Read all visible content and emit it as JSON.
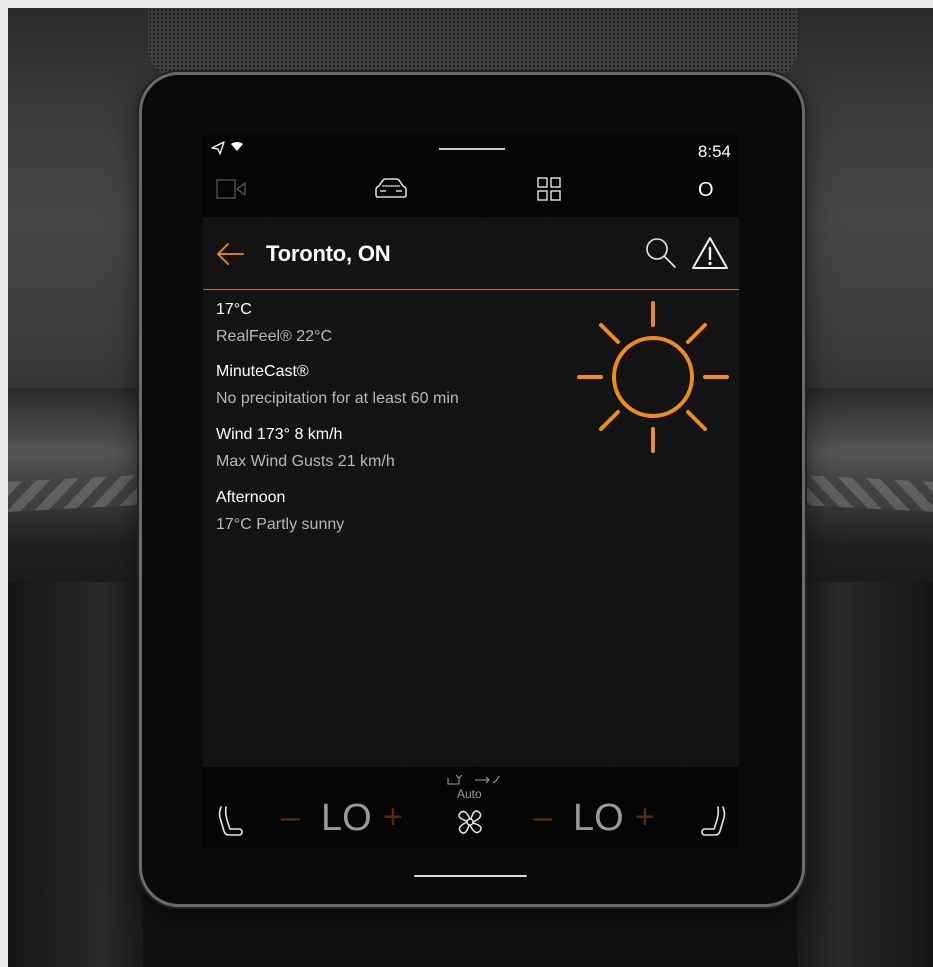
{
  "status_bar": {
    "time": "8:54"
  },
  "app_bar": {
    "icons": [
      "camera-icon",
      "car-icon",
      "app-grid-icon",
      "profile-icon"
    ],
    "profile_label": "O"
  },
  "weather": {
    "city": "Toronto, ON",
    "temperature": "17°C",
    "realfeel": "RealFeel® 22°C",
    "minutecast_title": "MinuteCast®",
    "minutecast_text": "No precipitation for at least 60 min",
    "wind": "Wind 173° 8 km/h",
    "gusts": "Max Wind Gusts 21 km/h",
    "period_title": "Afternoon",
    "period_text": "17°C Partly sunny",
    "condition_icon": "sunny-icon"
  },
  "climate": {
    "left_temp": "LO",
    "right_temp": "LO",
    "minus": "–",
    "plus": "+",
    "fan_mode": "Auto"
  },
  "colors": {
    "accent": "#f28a1c",
    "divider": "#c8651c",
    "background": "#050505"
  }
}
